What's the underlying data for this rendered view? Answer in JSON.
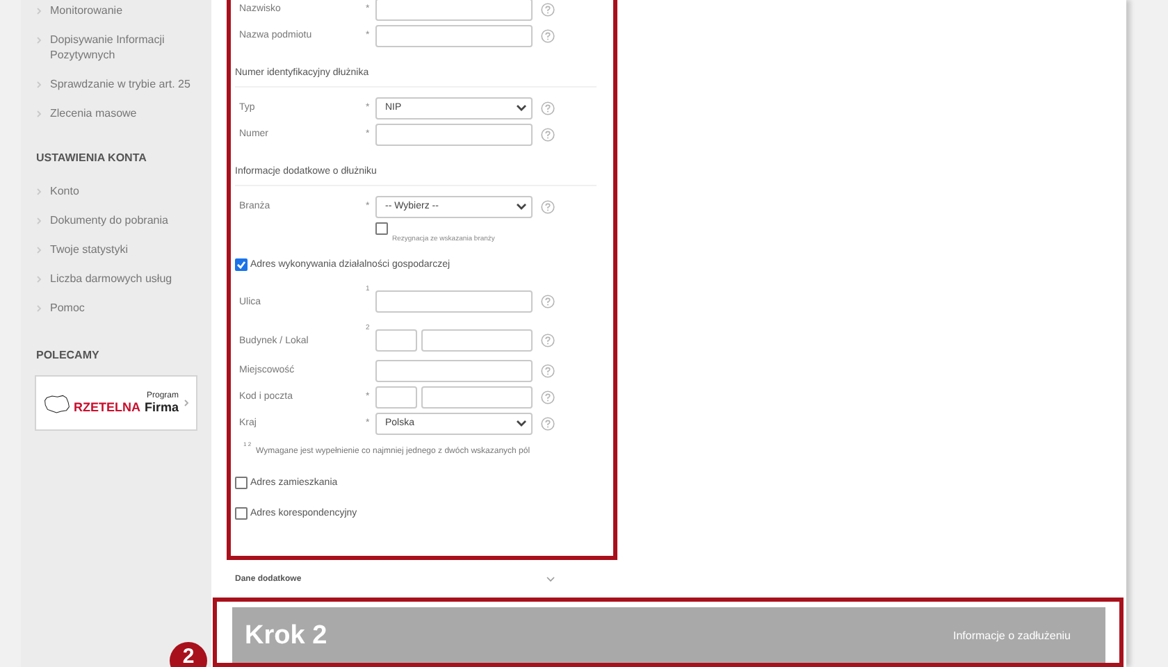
{
  "sidebar": {
    "groups": [
      {
        "items": [
          {
            "label": "Monitorowanie"
          },
          {
            "label": "Dopisywanie Informacji Pozytywnych"
          },
          {
            "label": "Sprawdzanie w trybie art. 25"
          },
          {
            "label": "Zlecenia masowe"
          }
        ]
      },
      {
        "heading": "USTAWIENIA KONTA",
        "items": [
          {
            "label": "Konto"
          },
          {
            "label": "Dokumenty do pobrania"
          },
          {
            "label": "Twoje statystyki"
          },
          {
            "label": "Liczba darmowych usług"
          },
          {
            "label": "Pomoc"
          }
        ]
      }
    ],
    "promo": {
      "heading": "POLECAMY",
      "program": "Program",
      "brand_red": "RZETELNA",
      "brand": "Firma"
    }
  },
  "form": {
    "rows": [
      {
        "kind": "input",
        "label": "Nazwisko",
        "marker": "*"
      },
      {
        "kind": "input",
        "label": "Nazwa podmiotu",
        "marker": "*"
      },
      {
        "kind": "section",
        "label": "Numer identyfikacyjny dłużnika"
      },
      {
        "kind": "select",
        "label": "Typ",
        "marker": "*",
        "value": "NIP"
      },
      {
        "kind": "input",
        "label": "Numer",
        "marker": "*"
      },
      {
        "kind": "section",
        "label": "Informacje dodatkowe o dłużniku"
      },
      {
        "kind": "select",
        "label": "Branża",
        "marker": "*",
        "value": "-- Wybierz --"
      },
      {
        "kind": "subcheck",
        "label": "Rezygnacja ze wskazania branży",
        "checked": false
      },
      {
        "kind": "checkbox",
        "label": "Adres wykonywania działalności gospodarczej",
        "checked": true
      },
      {
        "kind": "input",
        "label": "Ulica",
        "marker": "1"
      },
      {
        "kind": "pair",
        "label": "Budynek / Lokal",
        "marker": "2"
      },
      {
        "kind": "input",
        "label": "Miejscowość"
      },
      {
        "kind": "pair",
        "label": "Kod i poczta",
        "marker": "*"
      },
      {
        "kind": "select",
        "label": "Kraj",
        "marker": "*",
        "value": "Polska"
      },
      {
        "kind": "note",
        "marks": "1 2",
        "text": "Wymagane jest wypełnienie co najmniej jednego z dwóch wskazanych pól"
      },
      {
        "kind": "checkbox",
        "label": "Adres zamieszkania",
        "checked": false
      },
      {
        "kind": "checkbox",
        "label": "Adres korespondencyjny",
        "checked": false
      }
    ]
  },
  "extra": {
    "label": "Dane dodatkowe",
    "expanded": false
  },
  "step": {
    "badge": "2",
    "title": "Krok 2",
    "subtitle": "Informacje o zadłużeniu"
  }
}
